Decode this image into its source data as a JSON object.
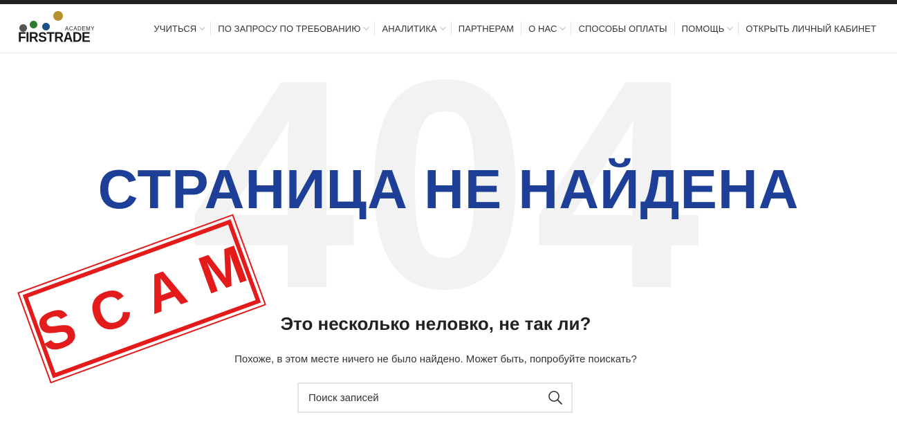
{
  "colors": {
    "accent": "#1e3f97",
    "stamp_red": "#e31b1b",
    "topbar": "#222222",
    "bg_number": "#f2f2f2"
  },
  "logo": {
    "word": "FIRSTRADE",
    "sub": "ACADEMY"
  },
  "nav": {
    "items": [
      {
        "label": "УЧИТЬСЯ",
        "has_dropdown": true
      },
      {
        "label": "ПО ЗАПРОСУ ПО ТРЕБОВАНИЮ",
        "has_dropdown": true
      },
      {
        "label": "АНАЛИТИКА",
        "has_dropdown": true
      },
      {
        "label": "ПАРТНЕРАМ",
        "has_dropdown": false
      },
      {
        "label": "О НАС",
        "has_dropdown": true
      },
      {
        "label": "СПОСОБЫ ОПЛАТЫ",
        "has_dropdown": false
      },
      {
        "label": "ПОМОЩЬ",
        "has_dropdown": true
      },
      {
        "label": "ОТКРЫТЬ ЛИЧНЫЙ КАБИНЕТ",
        "has_dropdown": false
      }
    ]
  },
  "error": {
    "code": "404",
    "title": "СТРАНИЦА НЕ НАЙДЕНА",
    "subtitle": "Это несколько неловко, не так ли?",
    "description": "Похоже, в этом месте ничего не было найдено. Может быть, попробуйте поискать?"
  },
  "search": {
    "placeholder": "Поиск записей",
    "icon": "search-icon"
  },
  "stamp": {
    "text": "SCAM"
  }
}
